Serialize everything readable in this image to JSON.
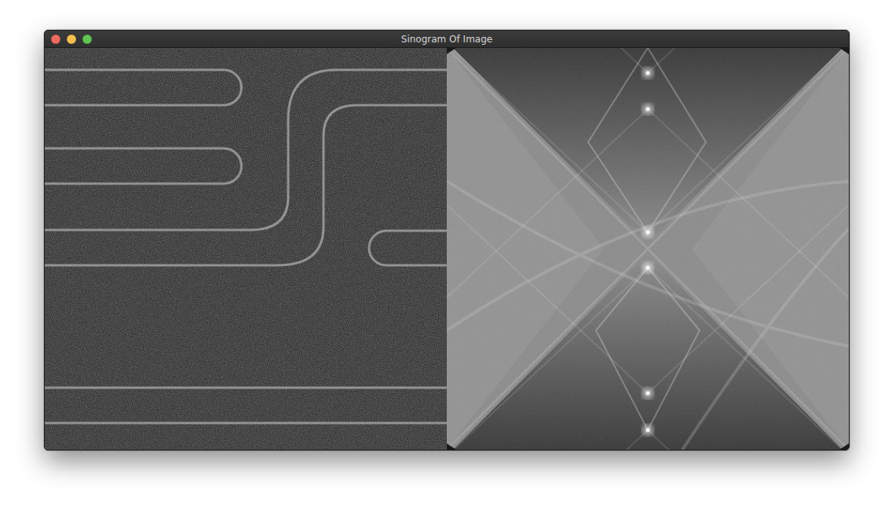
{
  "window": {
    "title": "Sinogram Of Image"
  },
  "controls": [
    {
      "name": "close",
      "color": "#ed6a5e"
    },
    {
      "name": "minimize",
      "color": "#f5bf4f"
    },
    {
      "name": "zoom",
      "color": "#61c554"
    }
  ]
}
